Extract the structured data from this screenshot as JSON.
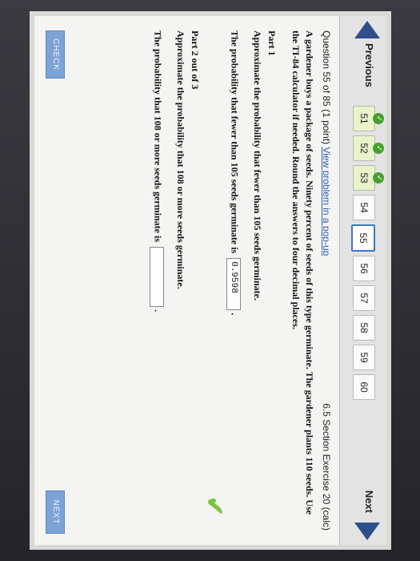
{
  "nav": {
    "previous_label": "Previous",
    "next_label": "Next",
    "pages": [
      {
        "label": "51",
        "completed": true
      },
      {
        "label": "52",
        "completed": true
      },
      {
        "label": "53",
        "completed": true
      },
      {
        "label": "54",
        "completed": false
      },
      {
        "label": "55",
        "completed": false,
        "current": true
      },
      {
        "label": "56",
        "completed": false
      },
      {
        "label": "57",
        "completed": false
      },
      {
        "label": "58",
        "completed": false
      },
      {
        "label": "59",
        "completed": false
      },
      {
        "label": "60",
        "completed": false
      }
    ]
  },
  "question": {
    "header": "Question 55 of 85 (1 point)",
    "popup_link": "View problem in a pop-up",
    "section": "6.5 Section Exercise 20 (calc)",
    "problem": "A gardener buys a package of seeds. Ninety percent of seeds of this type germinate. The gardener plants 110 seeds. Use the TI-84 calculator if needed. Round the answers to four decimal places."
  },
  "part1": {
    "title": "Part 1",
    "prompt": "Approximate the probability that fewer than 105 seeds germinate.",
    "answer_lead": "The probability that fewer than 105 seeds germinate is",
    "answer_value": "0.9598",
    "answer_trail": "."
  },
  "part2": {
    "title": "Part 2 out of 3",
    "prompt": "Approximate the probability that 108 or more seeds germinate.",
    "answer_lead": "The probability that 108 or more seeds germinate is",
    "answer_value": "",
    "answer_trail": "."
  },
  "buttons": {
    "check": "CHECK",
    "next": "NEXT"
  },
  "colors": {
    "nav_arrow": "#2f4f8a",
    "completed_check": "#45a02e",
    "current_tab_border": "#3a78c9",
    "correct_mark": "#7cc43d",
    "button": "#7da3d6"
  }
}
